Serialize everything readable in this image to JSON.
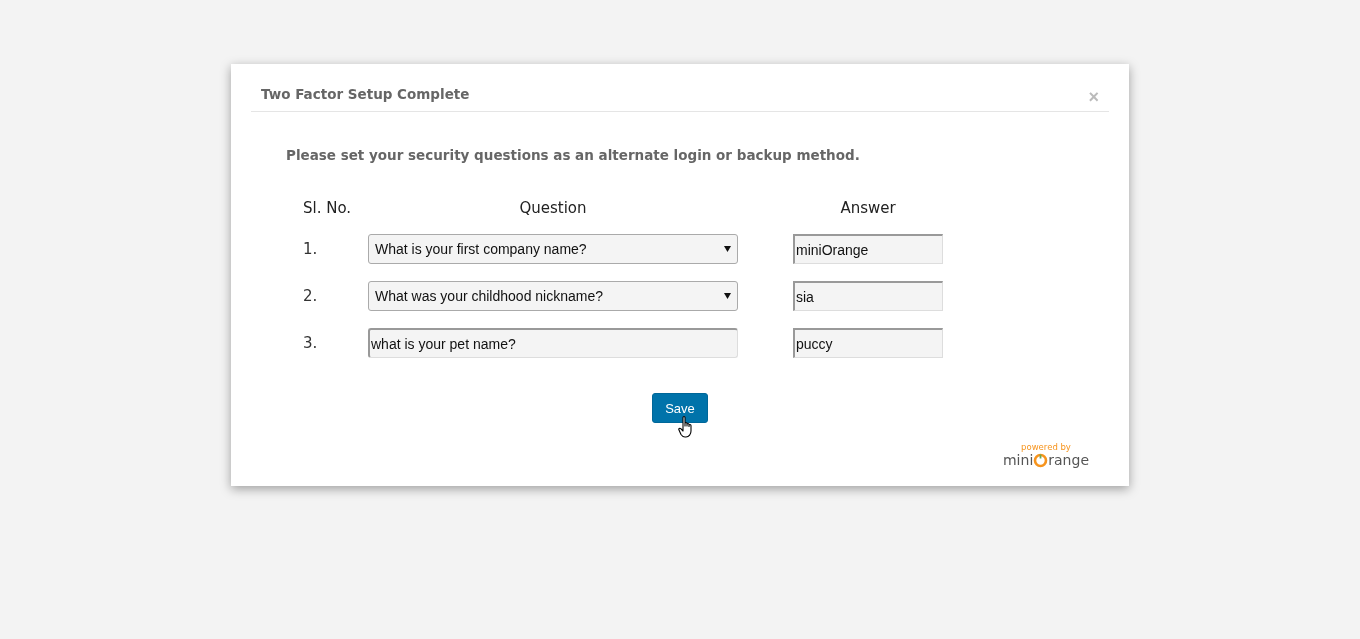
{
  "dialog": {
    "title": "Two Factor Setup Complete",
    "close": "×"
  },
  "intro": "Please set your security questions as an alternate login or backup method.",
  "columns": [
    "Sl. No.",
    "Question",
    "Answer"
  ],
  "rows": [
    {
      "number": "1.",
      "kind": "select",
      "question": "What is your first company name?",
      "answer": "miniOrange"
    },
    {
      "number": "2.",
      "kind": "select",
      "question": "What was your childhood nickname?",
      "answer": "sia"
    },
    {
      "number": "3.",
      "kind": "text",
      "question": "what is your pet name?",
      "answer": "puccy"
    }
  ],
  "save_button": "Save",
  "branding": {
    "powered_by": "powered by",
    "name_start": "mini",
    "name_end": "range"
  }
}
